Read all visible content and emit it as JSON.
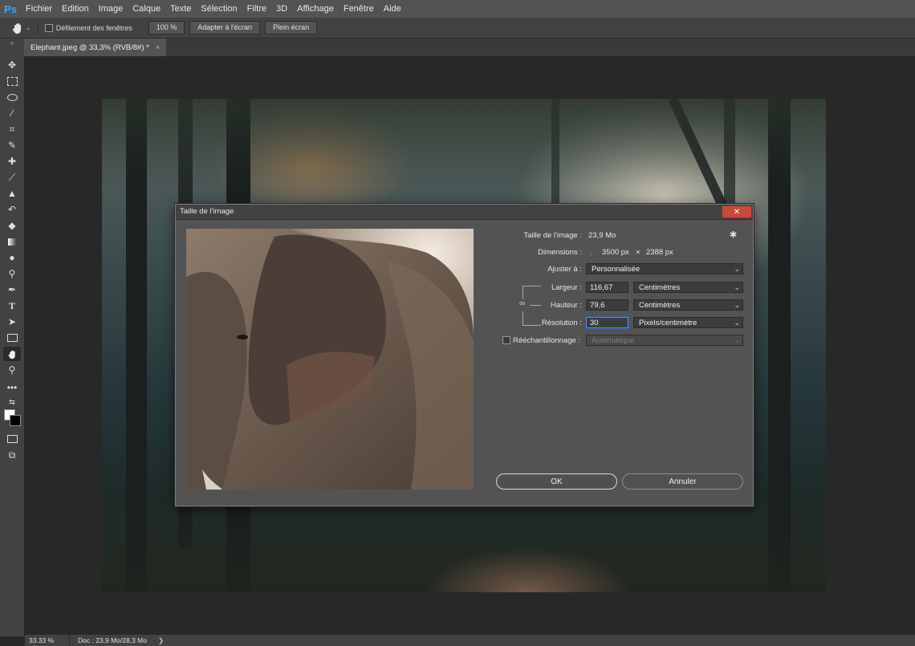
{
  "app": {
    "logo": "Ps",
    "menu": [
      "Fichier",
      "Edition",
      "Image",
      "Calque",
      "Texte",
      "Sélection",
      "Filtre",
      "3D",
      "Affichage",
      "Fenêtre",
      "Aide"
    ]
  },
  "options_bar": {
    "tool_icon": "hand-icon",
    "scroll_all_windows": "Défilement des fenêtres",
    "zoom_100": "100 %",
    "fit_screen": "Adapter à l'écran",
    "fill_screen": "Plein écran"
  },
  "document": {
    "tab_label": "Elephant.jpeg @ 33,3% (RVB/8#) *",
    "close_glyph": "×"
  },
  "status_bar": {
    "zoom": "33.33 %",
    "doc_info": "Doc : 23,9 Mo/28,3 Mo",
    "arrow": "❯"
  },
  "dialog": {
    "title": "Taille de l'image",
    "close_glyph": "✕",
    "image_size_label": "Taille de l'image :",
    "image_size_value": "23,9 Mo",
    "dimensions_label": "Dimensions :",
    "dimensions_width": "3500 px",
    "dimensions_times": "×",
    "dimensions_height": "2388 px",
    "fit_to_label": "Ajuster à :",
    "fit_to_value": "Personnalisée",
    "width_label": "Largeur :",
    "width_value": "116,67",
    "width_unit": "Centimètres",
    "height_label": "Hauteur :",
    "height_value": "79,6",
    "height_unit": "Centimètres",
    "resolution_label": "Résolution :",
    "resolution_value": "30",
    "resolution_unit": "Pixels/centimètre",
    "resample_label": "Rééchantillonnage :",
    "resample_value": "Automatique",
    "ok_label": "OK",
    "cancel_label": "Annuler"
  },
  "colors": {
    "accent": "#31a8ff",
    "close_button": "#c74b3c",
    "focus": "#4d8fde"
  }
}
